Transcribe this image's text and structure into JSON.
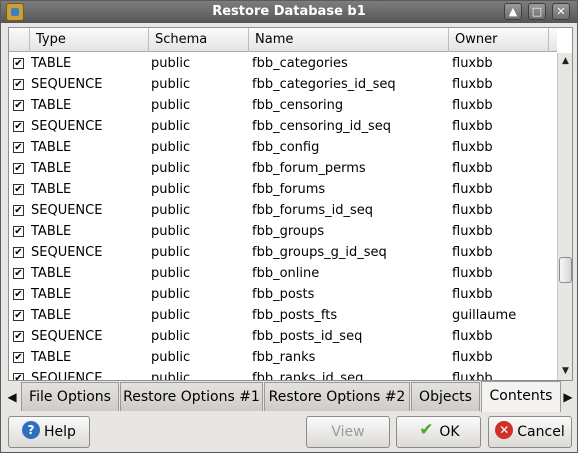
{
  "window": {
    "title": "Restore Database b1"
  },
  "table": {
    "columns": [
      "Type",
      "Schema",
      "Name",
      "Owner"
    ],
    "rows": [
      {
        "type": "TABLE",
        "schema": "public",
        "name": "fbb_categories",
        "owner": "fluxbb"
      },
      {
        "type": "SEQUENCE",
        "schema": "public",
        "name": "fbb_categories_id_seq",
        "owner": "fluxbb"
      },
      {
        "type": "TABLE",
        "schema": "public",
        "name": "fbb_censoring",
        "owner": "fluxbb"
      },
      {
        "type": "SEQUENCE",
        "schema": "public",
        "name": "fbb_censoring_id_seq",
        "owner": "fluxbb"
      },
      {
        "type": "TABLE",
        "schema": "public",
        "name": "fbb_config",
        "owner": "fluxbb"
      },
      {
        "type": "TABLE",
        "schema": "public",
        "name": "fbb_forum_perms",
        "owner": "fluxbb"
      },
      {
        "type": "TABLE",
        "schema": "public",
        "name": "fbb_forums",
        "owner": "fluxbb"
      },
      {
        "type": "SEQUENCE",
        "schema": "public",
        "name": "fbb_forums_id_seq",
        "owner": "fluxbb"
      },
      {
        "type": "TABLE",
        "schema": "public",
        "name": "fbb_groups",
        "owner": "fluxbb"
      },
      {
        "type": "SEQUENCE",
        "schema": "public",
        "name": "fbb_groups_g_id_seq",
        "owner": "fluxbb"
      },
      {
        "type": "TABLE",
        "schema": "public",
        "name": "fbb_online",
        "owner": "fluxbb"
      },
      {
        "type": "TABLE",
        "schema": "public",
        "name": "fbb_posts",
        "owner": "fluxbb"
      },
      {
        "type": "TABLE",
        "schema": "public",
        "name": "fbb_posts_fts",
        "owner": "guillaume"
      },
      {
        "type": "SEQUENCE",
        "schema": "public",
        "name": "fbb_posts_id_seq",
        "owner": "fluxbb"
      },
      {
        "type": "TABLE",
        "schema": "public",
        "name": "fbb_ranks",
        "owner": "fluxbb"
      },
      {
        "type": "SEQUENCE",
        "schema": "public",
        "name": "fbb_ranks_id_seq",
        "owner": "fluxbb"
      }
    ],
    "checkbox_mark": "✔"
  },
  "tabs": [
    {
      "label": "File Options",
      "active": false
    },
    {
      "label": "Restore Options #1",
      "active": false
    },
    {
      "label": "Restore Options #2",
      "active": false
    },
    {
      "label": "Objects",
      "active": false
    },
    {
      "label": "Contents",
      "active": true
    }
  ],
  "buttons": {
    "help": "Help",
    "view": "View",
    "ok": "OK",
    "cancel": "Cancel"
  }
}
